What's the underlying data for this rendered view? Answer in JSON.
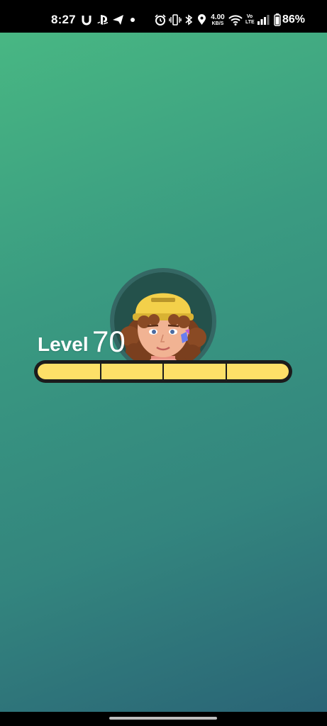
{
  "status_bar": {
    "time": "8:27",
    "network_speed_value": "4.00",
    "network_speed_unit": "KB/S",
    "volte_top": "Vo",
    "volte_bottom": "LTE",
    "battery_percent": "86%",
    "icons": [
      "u-app-icon",
      "playstation-icon",
      "send-icon",
      "dot-icon",
      "alarm-icon",
      "vibrate-icon",
      "bluetooth-icon",
      "location-icon",
      "wifi-icon",
      "signal-icon",
      "battery-icon"
    ]
  },
  "level_up": {
    "label": "Level",
    "number": "70",
    "xp_progress": 1.0,
    "xp_segments": 4,
    "colors": {
      "bar_fill": "#fde068",
      "bar_frame": "#1c1c1c",
      "background_top": "#48b783",
      "background_bottom": "#2a6476"
    }
  }
}
